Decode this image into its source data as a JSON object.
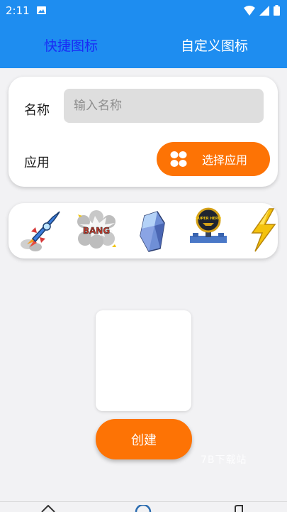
{
  "status_bar": {
    "time": "2:11"
  },
  "tabs": [
    {
      "label": "快捷图标",
      "active": true
    },
    {
      "label": "自定义图标",
      "active": false
    }
  ],
  "form": {
    "name_label": "名称",
    "name_placeholder": "输入名称",
    "app_label": "应用",
    "choose_app_button": "选择应用"
  },
  "icon_choices": [
    {
      "name": "rocket-icon"
    },
    {
      "name": "bang-comic-icon",
      "text": "BANG"
    },
    {
      "name": "crystal-icon"
    },
    {
      "name": "super-hero-badge-icon",
      "text": "SUPER HERO"
    },
    {
      "name": "lightning-icon"
    }
  ],
  "create_button": "创建",
  "watermark": "7B下载站",
  "colors": {
    "accent": "#fd7305",
    "app_bar": "#1e8df0",
    "active_tab": "#1a2cf5"
  }
}
